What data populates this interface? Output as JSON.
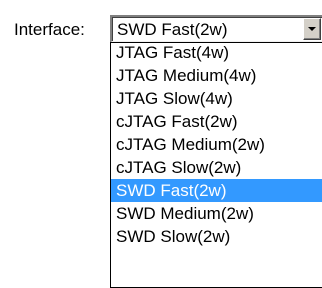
{
  "interface_field": {
    "label": "Interface:",
    "selected_value": "SWD Fast(2w)",
    "selected_index": 6,
    "options": [
      "JTAG Fast(4w)",
      "JTAG Medium(4w)",
      "JTAG Slow(4w)",
      "cJTAG Fast(2w)",
      "cJTAG Medium(2w)",
      "cJTAG Slow(2w)",
      "SWD Fast(2w)",
      "SWD Medium(2w)",
      "SWD Slow(2w)"
    ],
    "dropdown_icon": "chevron-down-icon"
  },
  "colors": {
    "highlight_background": "#3399ff",
    "highlight_text": "#ffffff",
    "button_face": "#d4d0c8"
  }
}
